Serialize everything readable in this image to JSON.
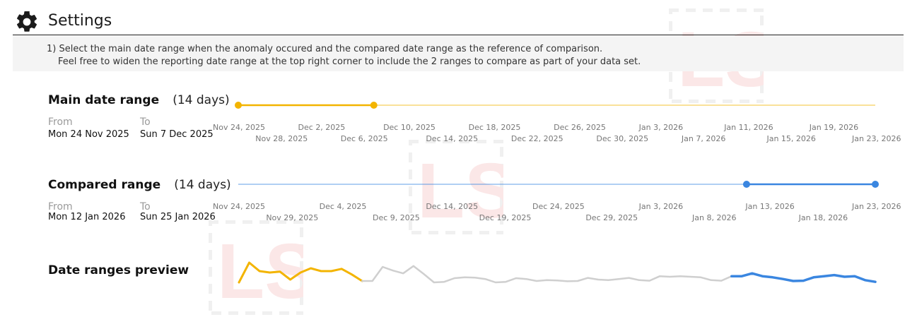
{
  "header": {
    "title": "Settings",
    "icon": "gear-icon"
  },
  "info": {
    "line1": "1) Select the main date range when the anomaly occured and the compared date range as the reference of comparison.",
    "line2": "Feel free to widen the reporting date range at the top right corner to include the 2 ranges to compare as part of your data set."
  },
  "main_range": {
    "label": "Main date range",
    "days": "(14 days)",
    "from_label": "From",
    "from_value": "Mon 24 Nov 2025",
    "to_label": "To",
    "to_value": "Sun 7 Dec 2025",
    "color": "#f3b400",
    "slider_start_fraction": 0.0,
    "slider_end_fraction": 0.2128,
    "ticks_top": [
      "Nov 24, 2025",
      "Dec 2, 2025",
      "Dec 10, 2025",
      "Dec 18, 2025",
      "Dec 26, 2025",
      "Jan 3, 2026",
      "Jan 11, 2026",
      "Jan 19, 2026"
    ],
    "ticks_bottom": [
      "Nov 28, 2025",
      "Dec 6, 2025",
      "Dec 14, 2025",
      "Dec 22, 2025",
      "Dec 30, 2025",
      "Jan 7, 2026",
      "Jan 15, 2026",
      "Jan 23, 2026"
    ]
  },
  "compared_range": {
    "label": "Compared range",
    "days": "(14 days)",
    "from_label": "From",
    "from_value": "Mon 12 Jan 2026",
    "to_label": "To",
    "to_value": "Sun 25 Jan 2026",
    "color": "#3a86e0",
    "slider_start_fraction": 0.7979,
    "slider_end_fraction": 1.0,
    "ticks_top": [
      "Nov 24, 2025",
      "Dec 4, 2025",
      "Dec 14, 2025",
      "Dec 24, 2025",
      "Jan 3, 2026",
      "Jan 13, 2026",
      "Jan 23, 2026"
    ],
    "ticks_bottom": [
      "Nov 29, 2025",
      "Dec 9, 2025",
      "Dec 19, 2025",
      "Dec 29, 2025",
      "Jan 8, 2026",
      "Jan 18, 2026"
    ]
  },
  "preview": {
    "label": "Date ranges preview",
    "main_color": "#f3b400",
    "compared_color": "#3a86e0",
    "other_color": "#cfcfcf",
    "main_values": [
      0.3,
      1.0,
      0.7,
      0.65,
      0.68,
      0.4,
      0.65,
      0.8,
      0.7,
      0.7,
      0.78,
      0.58,
      0.35
    ],
    "middle_values": [
      0.35,
      0.85,
      0.72,
      0.62,
      0.88,
      0.6,
      0.3,
      0.32,
      0.45,
      0.48,
      0.47,
      0.42,
      0.3,
      0.32,
      0.45,
      0.42,
      0.35,
      0.38,
      0.37,
      0.34,
      0.35,
      0.46,
      0.4,
      0.38,
      0.42,
      0.46,
      0.38,
      0.36,
      0.52,
      0.5,
      0.52,
      0.5,
      0.48,
      0.38,
      0.36,
      0.52
    ],
    "compared_values": [
      0.52,
      0.62,
      0.52,
      0.48,
      0.42,
      0.35,
      0.36,
      0.48,
      0.52,
      0.56,
      0.5,
      0.52,
      0.38,
      0.32
    ]
  }
}
